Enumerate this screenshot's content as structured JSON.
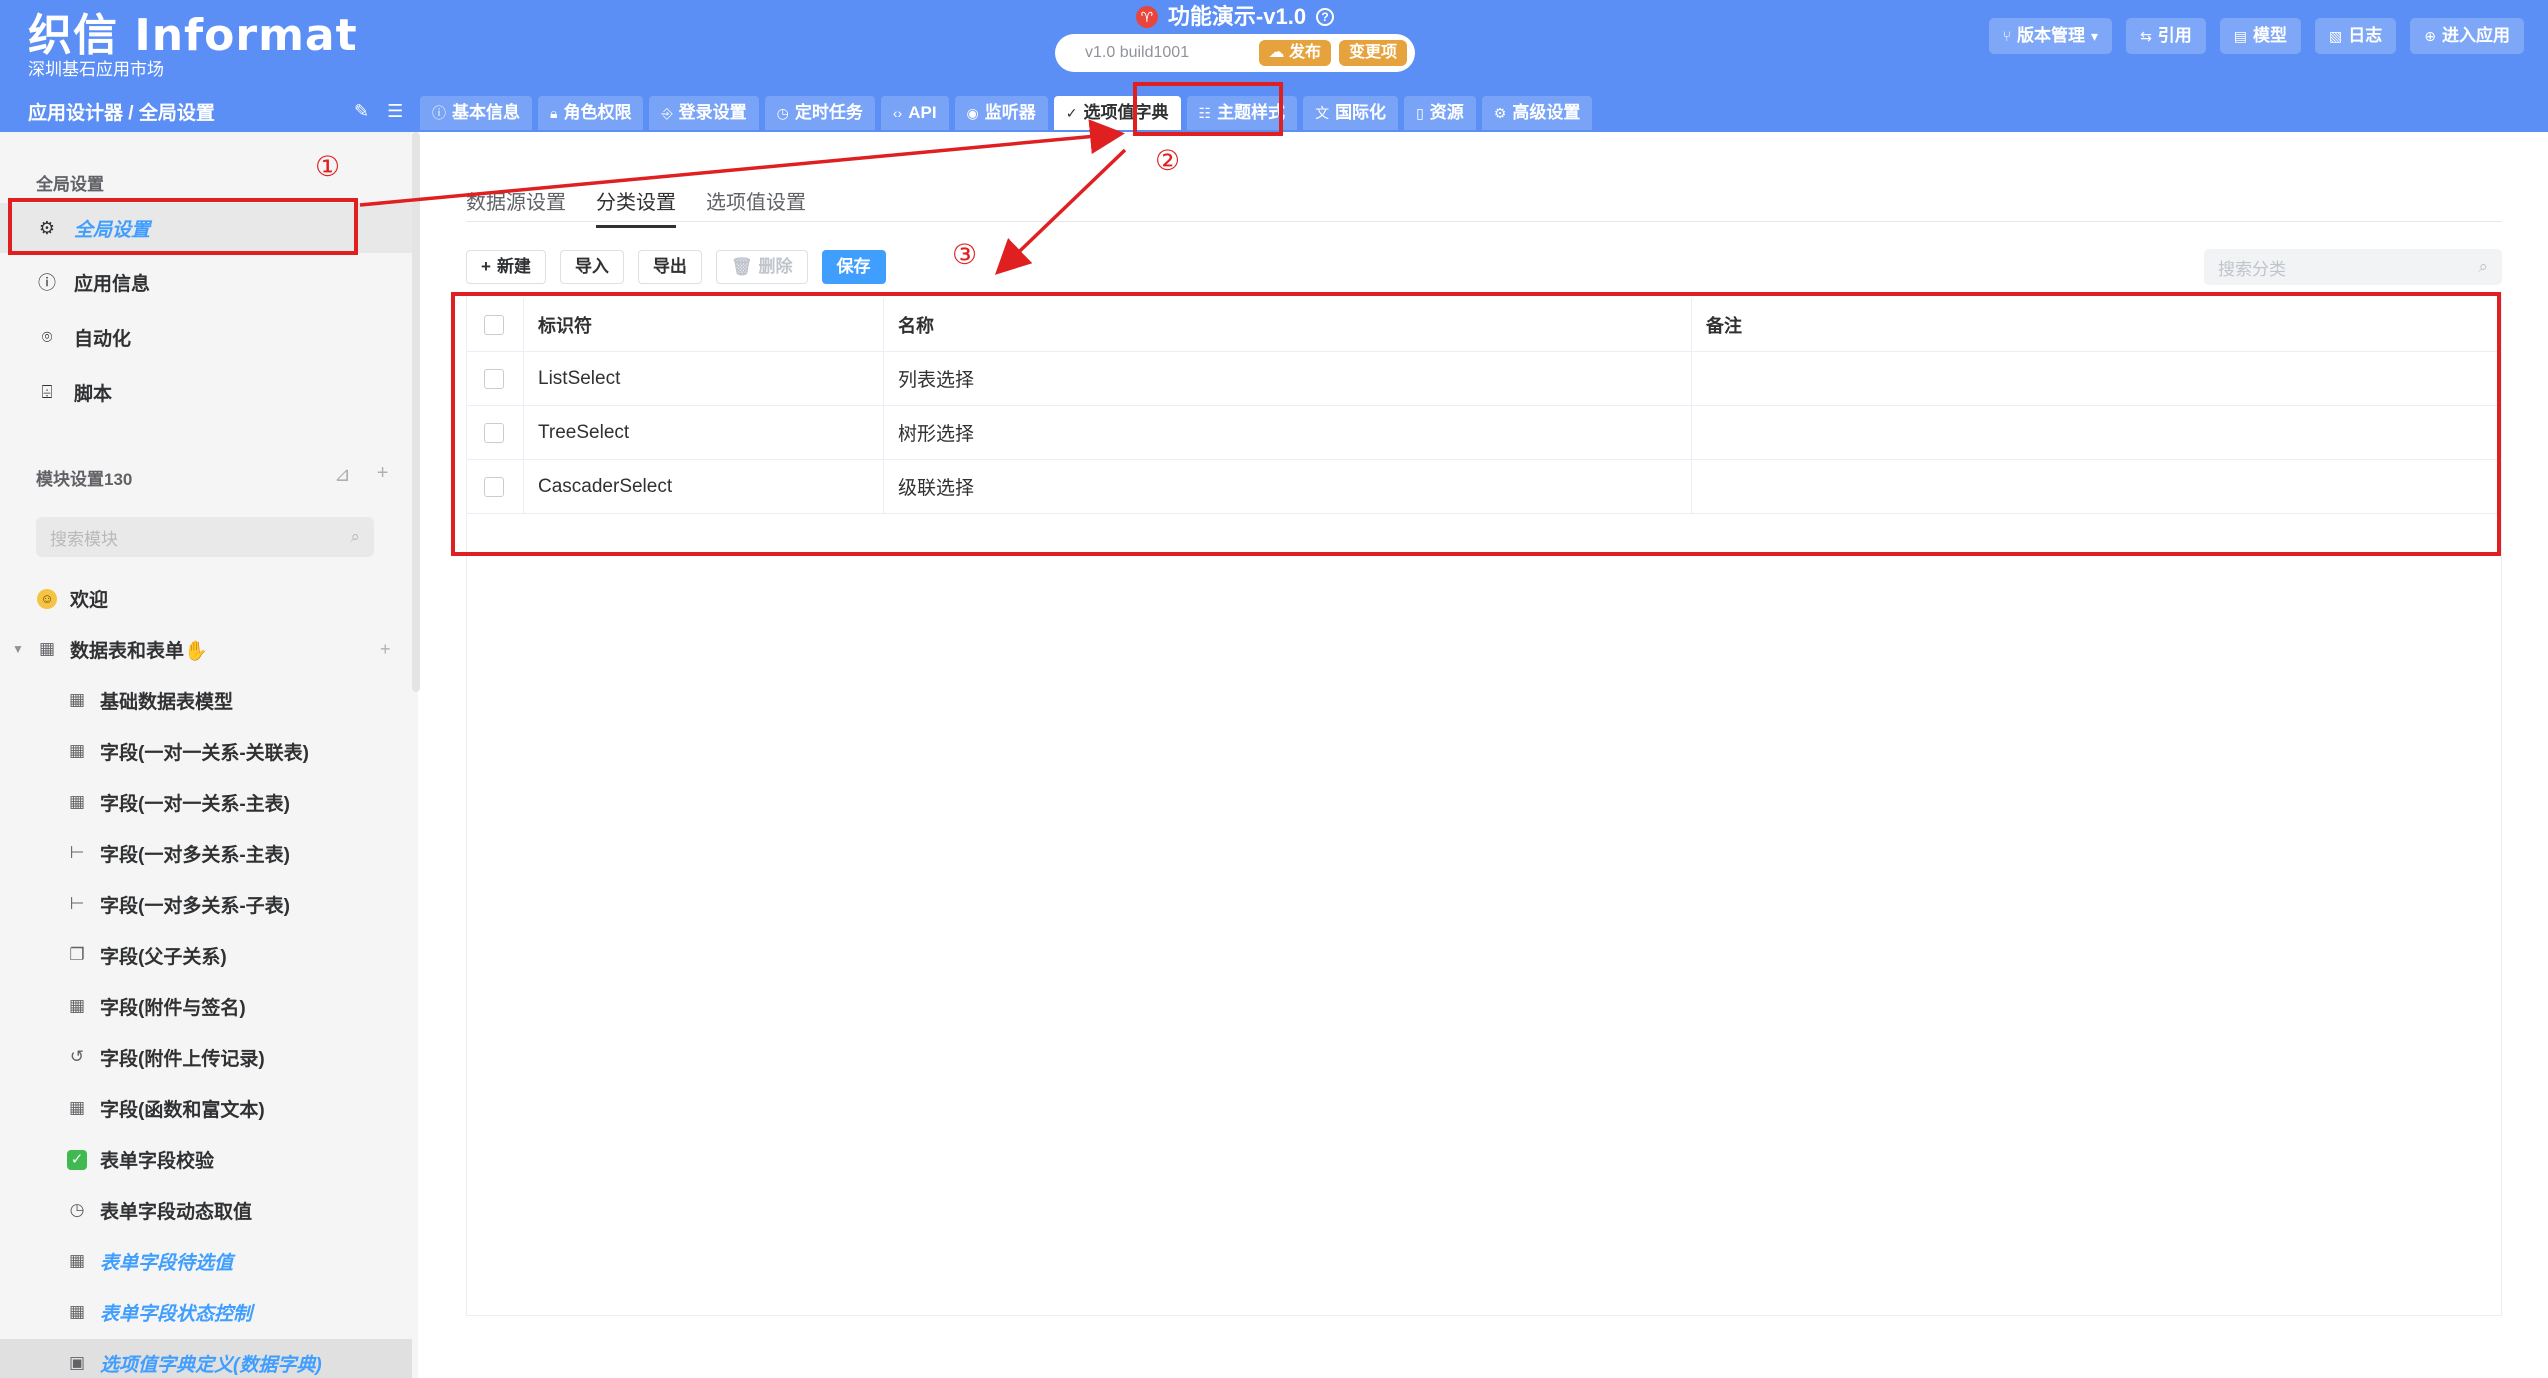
{
  "header": {
    "logo_title": "织信 Informat",
    "logo_subtitle": "深圳基石应用市场",
    "app_title": "功能演示-v1.0",
    "build": "v1.0 build1001",
    "publish_label": "发布",
    "changes_label": "变更项",
    "right_buttons": [
      {
        "icon": "branch-icon",
        "label": "版本管理"
      },
      {
        "icon": "link-icon",
        "label": "引用"
      },
      {
        "icon": "model-icon",
        "label": "模型"
      },
      {
        "icon": "log-icon",
        "label": "日志"
      },
      {
        "icon": "enter-icon",
        "label": "进入应用"
      }
    ],
    "breadcrumb": "应用设计器 / 全局设置",
    "tabs": [
      {
        "icon": "info-icon",
        "label": "基本信息"
      },
      {
        "icon": "lock-icon",
        "label": "角色权限"
      },
      {
        "icon": "login-icon",
        "label": "登录设置"
      },
      {
        "icon": "clock-icon",
        "label": "定时任务"
      },
      {
        "icon": "code-icon",
        "label": "API"
      },
      {
        "icon": "eye-icon",
        "label": "监听器"
      },
      {
        "icon": "check-circle-icon",
        "label": "选项值字典",
        "active": true
      },
      {
        "icon": "theme-icon",
        "label": "主题样式"
      },
      {
        "icon": "translate-icon",
        "label": "国际化"
      },
      {
        "icon": "resource-icon",
        "label": "资源"
      },
      {
        "icon": "gear-icon",
        "label": "高级设置"
      }
    ]
  },
  "sidebar": {
    "global_section": "全局设置",
    "global_items": [
      {
        "icon": "gear-icon",
        "label": "全局设置",
        "active": true
      },
      {
        "icon": "info-icon",
        "label": "应用信息"
      },
      {
        "icon": "robot-icon",
        "label": "自动化"
      },
      {
        "icon": "script-icon",
        "label": "脚本"
      }
    ],
    "module_section": "模块设置130",
    "search_placeholder": "搜索模块",
    "tree": [
      {
        "icon": "smile-icon",
        "label": "欢迎",
        "level": 1
      },
      {
        "icon": "table-icon",
        "label": "数据表和表单✋",
        "level": 1,
        "expanded": true
      },
      {
        "icon": "table-icon",
        "label": "基础数据表模型",
        "level": 2
      },
      {
        "icon": "table-icon",
        "label": "字段(一对一关系-关联表)",
        "level": 2
      },
      {
        "icon": "table-icon",
        "label": "字段(一对一关系-主表)",
        "level": 2
      },
      {
        "icon": "tree-icon",
        "label": "字段(一对多关系-主表)",
        "level": 2
      },
      {
        "icon": "tree-icon",
        "label": "字段(一对多关系-子表)",
        "level": 2
      },
      {
        "icon": "copy-icon",
        "label": "字段(父子关系)",
        "level": 2
      },
      {
        "icon": "table-icon",
        "label": "字段(附件与签名)",
        "level": 2
      },
      {
        "icon": "history-icon",
        "label": "字段(附件上传记录)",
        "level": 2
      },
      {
        "icon": "table-icon",
        "label": "字段(函数和富文本)",
        "level": 2
      },
      {
        "icon": "check-green-icon",
        "label": "表单字段校验",
        "level": 2
      },
      {
        "icon": "clock-icon",
        "label": "表单字段动态取值",
        "level": 2
      },
      {
        "icon": "table-icon",
        "label": "表单字段待选值",
        "level": 2,
        "blue": true
      },
      {
        "icon": "table-icon",
        "label": "表单字段状态控制",
        "level": 2,
        "blue": true
      },
      {
        "icon": "save-icon",
        "label": "选项值字典定义(数据字典)",
        "level": 2,
        "blue": true,
        "selected": true
      }
    ]
  },
  "content": {
    "subtabs": [
      {
        "label": "数据源设置"
      },
      {
        "label": "分类设置",
        "active": true
      },
      {
        "label": "选项值设置"
      }
    ],
    "toolbar": {
      "new": "新建",
      "import": "导入",
      "export": "导出",
      "delete": "删除",
      "save": "保存"
    },
    "search_placeholder": "搜索分类",
    "table": {
      "columns": [
        "标识符",
        "名称",
        "备注"
      ],
      "rows": [
        [
          "ListSelect",
          "列表选择",
          ""
        ],
        [
          "TreeSelect",
          "树形选择",
          ""
        ],
        [
          "CascaderSelect",
          "级联选择",
          ""
        ]
      ]
    }
  },
  "annotations": {
    "marker1": "①",
    "marker2": "②",
    "marker3": "③",
    "color": "#e02020"
  },
  "colors": {
    "header_bg": "#5b8ff5",
    "primary": "#409eff",
    "orange": "#e6a23c"
  }
}
